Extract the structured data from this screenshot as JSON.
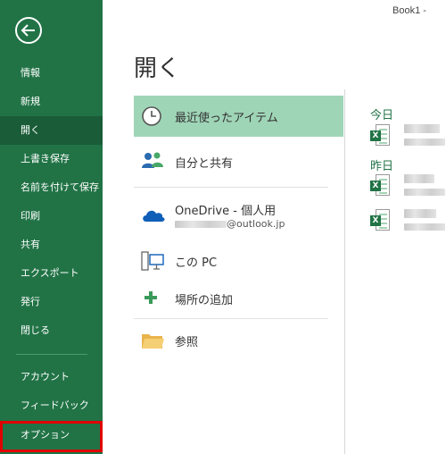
{
  "window": {
    "title": "Book1 -"
  },
  "sidebar": {
    "items": [
      {
        "label": "情報"
      },
      {
        "label": "新規"
      },
      {
        "label": "開く"
      },
      {
        "label": "上書き保存"
      },
      {
        "label": "名前を付けて保存"
      },
      {
        "label": "印刷"
      },
      {
        "label": "共有"
      },
      {
        "label": "エクスポート"
      },
      {
        "label": "発行"
      },
      {
        "label": "閉じる"
      },
      {
        "label": "アカウント"
      },
      {
        "label": "フィードバック"
      },
      {
        "label": "オプション"
      }
    ],
    "active_index": 2,
    "highlight_index": 12
  },
  "main": {
    "title": "開く",
    "locations": [
      {
        "label": "最近使ったアイテム",
        "icon": "clock-icon"
      },
      {
        "label": "自分と共有",
        "icon": "people-icon"
      },
      {
        "label": "OneDrive - 個人用",
        "sub": "@outlook.jp",
        "icon": "cloud-icon"
      },
      {
        "label": "この PC",
        "icon": "computer-icon"
      },
      {
        "label": "場所の追加",
        "icon": "plus-icon"
      },
      {
        "label": "参照",
        "icon": "folder-icon"
      }
    ],
    "recent": {
      "groups": [
        {
          "heading": "今日",
          "file_count": 1
        },
        {
          "heading": "昨日",
          "file_count": 2
        }
      ]
    }
  },
  "colors": {
    "sidebar_bg": "#217346",
    "sidebar_active": "#1a5c38",
    "selected_bg": "#9fd5b7",
    "highlight_border": "#e00000"
  }
}
